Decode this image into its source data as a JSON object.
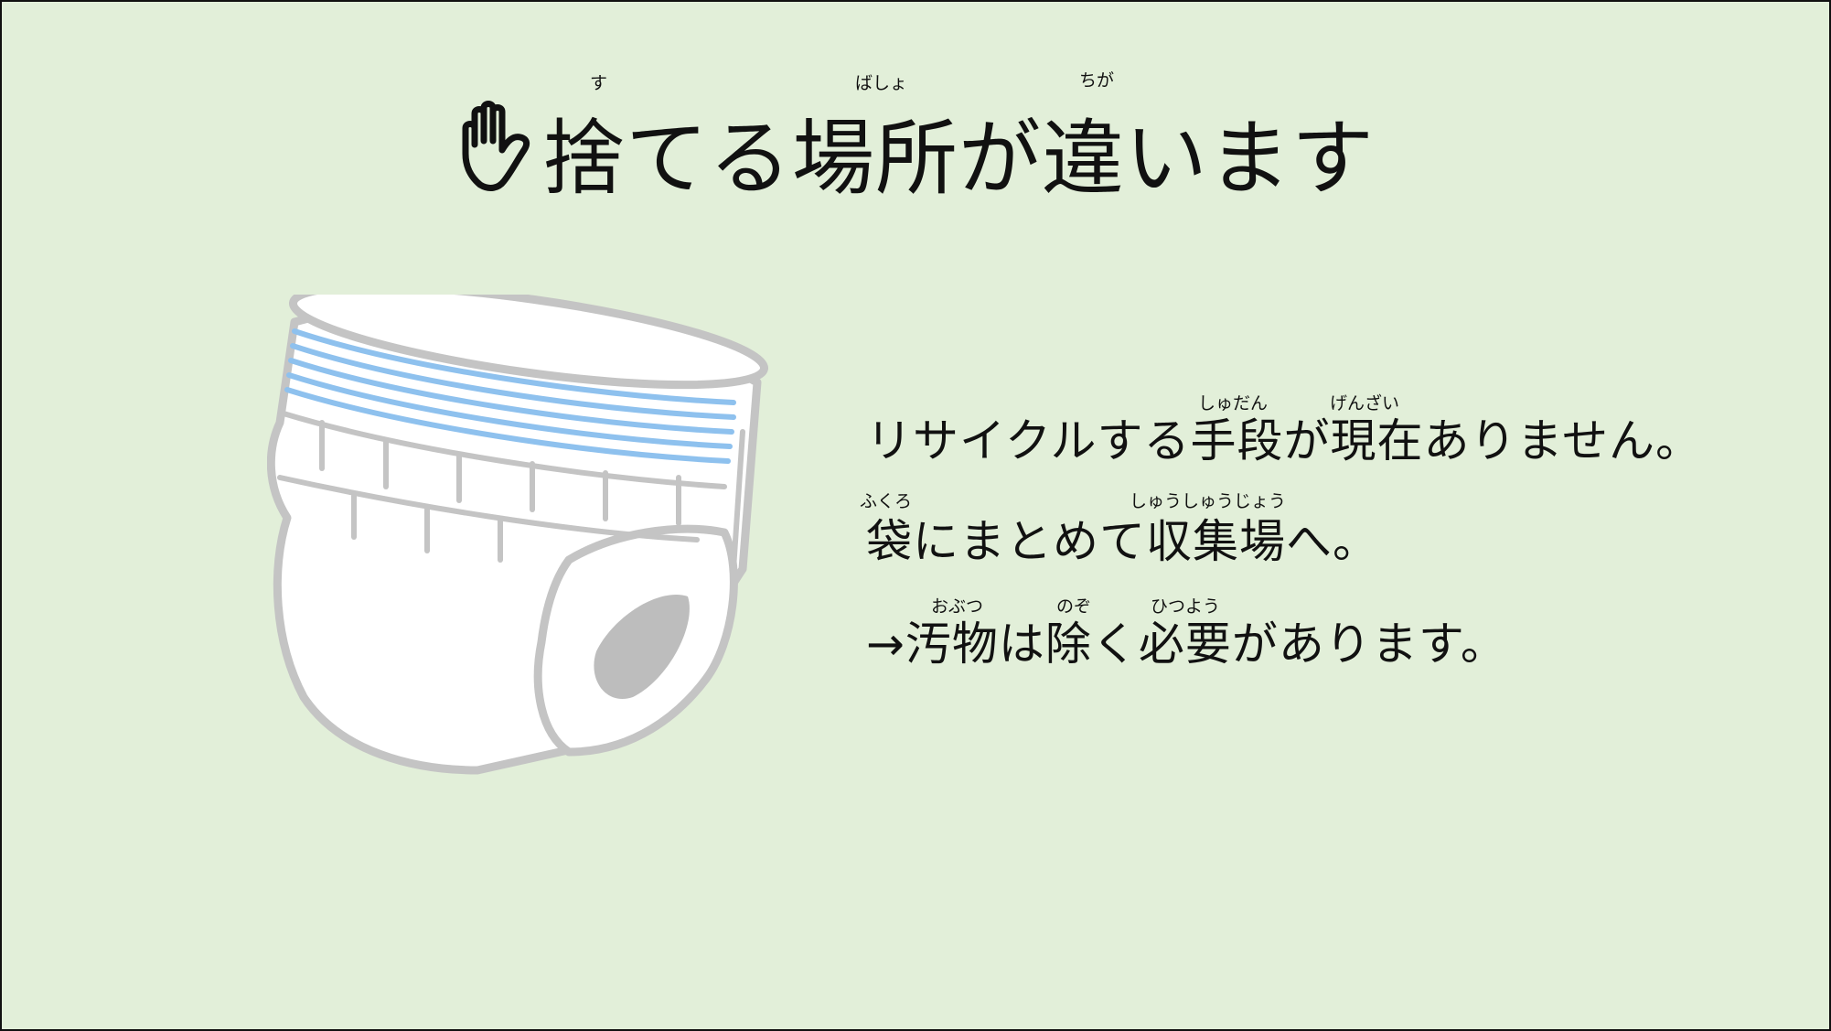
{
  "slide": {
    "background": "#e2efd9",
    "title": {
      "text": "捨てる場所が違います",
      "icon": "hand-stop-icon",
      "ruby": {
        "su": "す",
        "basho": "ばしょ",
        "chiga": "ちが"
      }
    },
    "lines": [
      {
        "text": "リサイクルする手段が現在ありません。",
        "ruby": [
          "しゅだん",
          "げんざい"
        ]
      },
      {
        "text": "袋にまとめて収集場へ。",
        "ruby": [
          "ふくろ",
          "しゅうしゅうじょう"
        ]
      },
      {
        "text": "→汚物は除く必要があります。",
        "ruby": [
          "おぶつ",
          "のぞ",
          "ひつよう"
        ]
      }
    ],
    "illustration": {
      "name": "diaper-illustration",
      "stripe_color": "#8ec1ee",
      "outline_color": "#c4c4c4"
    }
  }
}
